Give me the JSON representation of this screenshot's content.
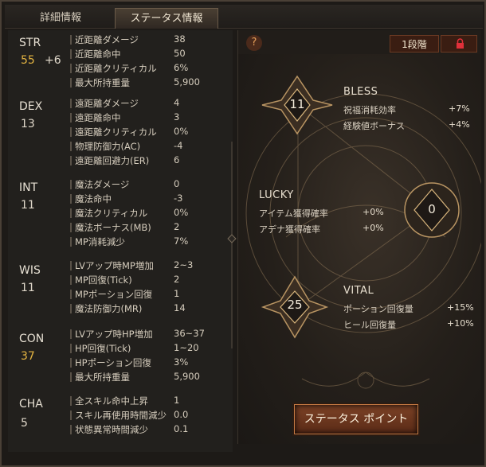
{
  "tabs": [
    {
      "label": "詳細情報"
    },
    {
      "label": "ステータス情報"
    }
  ],
  "stats": [
    {
      "name": "STR",
      "value": "55",
      "bonus": "+6",
      "rows": [
        {
          "label": "近距離ダメージ",
          "value": "38"
        },
        {
          "label": "近距離命中",
          "value": "50"
        },
        {
          "label": "近距離クリティカル",
          "value": "6%"
        },
        {
          "label": "最大所持重量",
          "value": "5,900"
        }
      ]
    },
    {
      "name": "DEX",
      "value": "13",
      "bonus": "",
      "rows": [
        {
          "label": "遠距離ダメージ",
          "value": "4"
        },
        {
          "label": "遠距離命中",
          "value": "3"
        },
        {
          "label": "遠距離クリティカル",
          "value": "0%"
        },
        {
          "label": "物理防御力(AC)",
          "value": "-4"
        },
        {
          "label": "遠距離回避力(ER)",
          "value": "6"
        }
      ]
    },
    {
      "name": "INT",
      "value": "11",
      "bonus": "",
      "rows": [
        {
          "label": "魔法ダメージ",
          "value": "0"
        },
        {
          "label": "魔法命中",
          "value": "-3"
        },
        {
          "label": "魔法クリティカル",
          "value": "0%"
        },
        {
          "label": "魔法ボーナス(MB)",
          "value": "2"
        },
        {
          "label": "MP消耗減少",
          "value": "7%"
        }
      ]
    },
    {
      "name": "WIS",
      "value": "11",
      "bonus": "",
      "rows": [
        {
          "label": "LVアップ時MP増加",
          "value": "2~3"
        },
        {
          "label": "MP回復(Tick)",
          "value": "2"
        },
        {
          "label": "MPポーション回復",
          "value": "1"
        },
        {
          "label": "魔法防御力(MR)",
          "value": "14"
        }
      ]
    },
    {
      "name": "CON",
      "value": "37",
      "bonus": "",
      "rows": [
        {
          "label": "LVアップ時HP増加",
          "value": "36~37"
        },
        {
          "label": "HP回復(Tick)",
          "value": "1~20"
        },
        {
          "label": "HPポーション回復",
          "value": "3%"
        },
        {
          "label": "最大所持重量",
          "value": "5,900"
        }
      ]
    },
    {
      "name": "CHA",
      "value": "5",
      "bonus": "",
      "rows": [
        {
          "label": "全スキル命中上昇",
          "value": "1"
        },
        {
          "label": "スキル再使用時間減少",
          "value": "0.0"
        },
        {
          "label": "状態異常時間減少",
          "value": "0.1"
        }
      ]
    }
  ],
  "right_panel": {
    "help": "?",
    "stage": "1段階",
    "bless": {
      "title": "BLESS",
      "points": "11",
      "rows": [
        {
          "label": "祝福消耗効率",
          "value": "+7%"
        },
        {
          "label": "経験値ボーナス",
          "value": "+4%"
        }
      ]
    },
    "lucky": {
      "title": "LUCKY",
      "points": "0",
      "rows": [
        {
          "label": "アイテム獲得確率",
          "value": "+0%"
        },
        {
          "label": "アデナ獲得確率",
          "value": "+0%"
        }
      ]
    },
    "vital": {
      "title": "VITAL",
      "points": "25",
      "rows": [
        {
          "label": "ポーション回復量",
          "value": "+15%"
        },
        {
          "label": "ヒール回復量",
          "value": "+10%"
        }
      ]
    },
    "button_label": "ステータス ポイント"
  },
  "colors": {
    "gold": "#e3b341",
    "accent": "#7c4226",
    "lock": "#e0303a"
  }
}
